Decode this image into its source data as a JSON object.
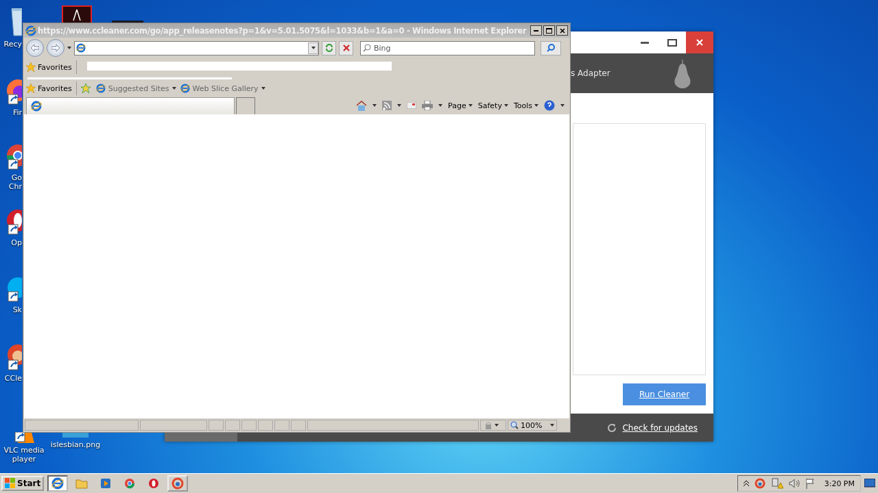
{
  "desktop_icons": [
    {
      "kind": "recycle-bin",
      "label": "Recy"
    },
    {
      "kind": "pdf"
    },
    {
      "kind": "dark-app"
    },
    {
      "kind": "firefox",
      "label": "Fir"
    },
    {
      "kind": "chrome",
      "label": "Go\nChr"
    },
    {
      "kind": "opera",
      "label": "Op"
    },
    {
      "kind": "skype",
      "label": "Sk"
    },
    {
      "kind": "ccleaner",
      "label": "CCle"
    },
    {
      "kind": "vlc",
      "label": "VLC media\nplayer"
    },
    {
      "kind": "image-file",
      "label": "islesbian.png"
    }
  ],
  "ccleaner_window": {
    "header_text": "s Adapter",
    "run_button": "Run Cleaner",
    "update_link": "Check for updates"
  },
  "ie_window": {
    "title": "https://www.ccleaner.com/go/app_releasenotes?p=1&v=5.01.5075&l=1033&b=1&a=0 - Windows Internet Explorer",
    "search_placeholder": "Bing",
    "favorites_label": "Favorites",
    "favorites_label_2": "Favorites",
    "favorite_links": [
      {
        "label": "Suggested Sites"
      },
      {
        "label": "Web Slice Gallery"
      }
    ],
    "commands": [
      {
        "label": "Page"
      },
      {
        "label": "Safety"
      },
      {
        "label": "Tools"
      }
    ],
    "zoom": "100%"
  },
  "taskbar": {
    "start": "Start",
    "apps": [
      {
        "kind": "ie",
        "selected": true
      },
      {
        "kind": "explorer",
        "selected": false
      },
      {
        "kind": "media",
        "selected": false
      },
      {
        "kind": "chrome",
        "selected": false
      },
      {
        "kind": "opera",
        "selected": false
      },
      {
        "kind": "ccleaner",
        "selected": false,
        "open": true
      }
    ],
    "clock": "3:20 PM"
  }
}
